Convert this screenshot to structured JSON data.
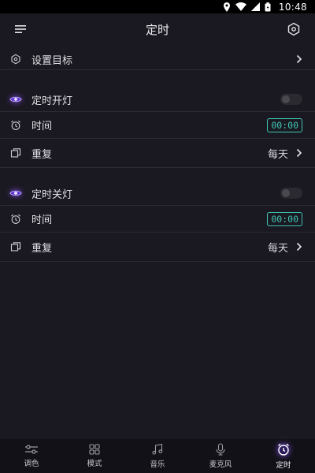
{
  "statusbar": {
    "time": "10:48"
  },
  "header": {
    "title": "定时"
  },
  "set_goal": {
    "label": "设置目标"
  },
  "on_timer": {
    "title": "定时开灯",
    "time_label": "时间",
    "time_value": "00:00",
    "repeat_label": "重复",
    "repeat_value": "每天",
    "enabled": false
  },
  "off_timer": {
    "title": "定时关灯",
    "time_label": "时间",
    "time_value": "00:00",
    "repeat_label": "重复",
    "repeat_value": "每天",
    "enabled": false
  },
  "tabs": [
    {
      "label": "调色",
      "icon": "sliders-icon"
    },
    {
      "label": "模式",
      "icon": "grid-icon"
    },
    {
      "label": "音乐",
      "icon": "music-icon"
    },
    {
      "label": "麦克风",
      "icon": "mic-icon"
    },
    {
      "label": "定时",
      "icon": "alarm-icon",
      "active": true
    }
  ],
  "colors": {
    "accent": "#3fc6b3",
    "glow": "#8a53ff",
    "background": "#1a1820"
  }
}
